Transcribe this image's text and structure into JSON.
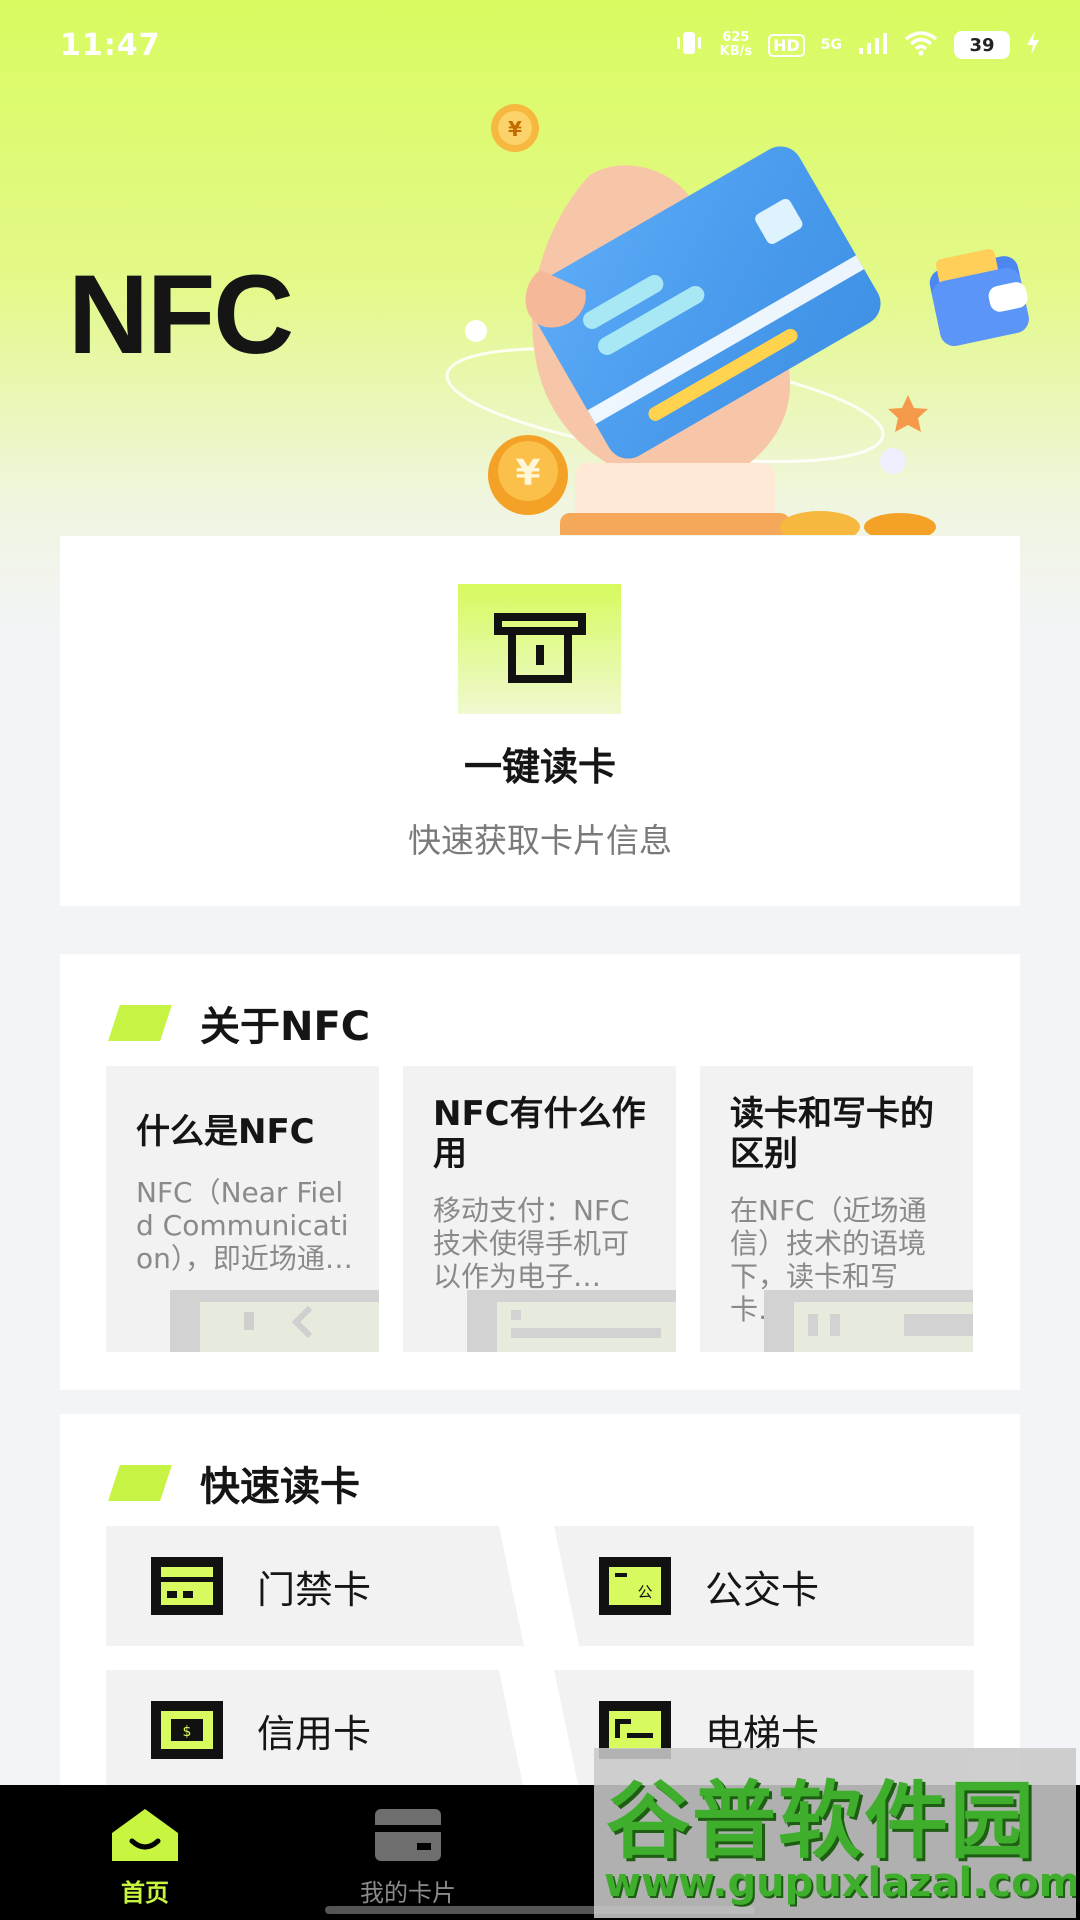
{
  "status_bar": {
    "time": "11:47",
    "net_speed_value": "625",
    "net_speed_unit": "KB/s",
    "hd_label": "HD",
    "network_label": "5G",
    "battery": "39"
  },
  "hero": {
    "title": "NFC",
    "coin_symbol": "¥"
  },
  "read_card": {
    "title": "一键读卡",
    "subtitle": "快速获取卡片信息"
  },
  "about_section": {
    "title": "关于NFC",
    "items": [
      {
        "title": "什么是NFC",
        "desc": "NFC（Near Field Communication），即近场通…"
      },
      {
        "title": "NFC有什么作用",
        "desc": "移动支付：NFC技术使得手机可以作为电子…"
      },
      {
        "title": "读卡和写卡的区别",
        "desc": "在NFC（近场通信）技术的语境下，读卡和写卡…"
      }
    ]
  },
  "quick_section": {
    "title": "快速读卡",
    "items": [
      {
        "label": "门禁卡",
        "icon": "access-card-icon"
      },
      {
        "label": "公交卡",
        "icon": "bus-card-icon",
        "icon_text": "公"
      },
      {
        "label": "信用卡",
        "icon": "credit-card-icon",
        "icon_text": "$"
      },
      {
        "label": "电梯卡",
        "icon": "elevator-card-icon"
      }
    ]
  },
  "tab_bar": {
    "tabs": [
      {
        "label": "首页",
        "icon": "home-icon",
        "active": true
      },
      {
        "label": "我的卡片",
        "icon": "card-wallet-icon",
        "active": false
      }
    ]
  },
  "watermark": {
    "title": "谷普软件园",
    "url": "www.gupuxlazal.com"
  },
  "colors": {
    "accent": "#c8f540",
    "hero_top": "#d9fa60",
    "background": "#f3f4f7",
    "watermark_green": "#3fae2d"
  }
}
